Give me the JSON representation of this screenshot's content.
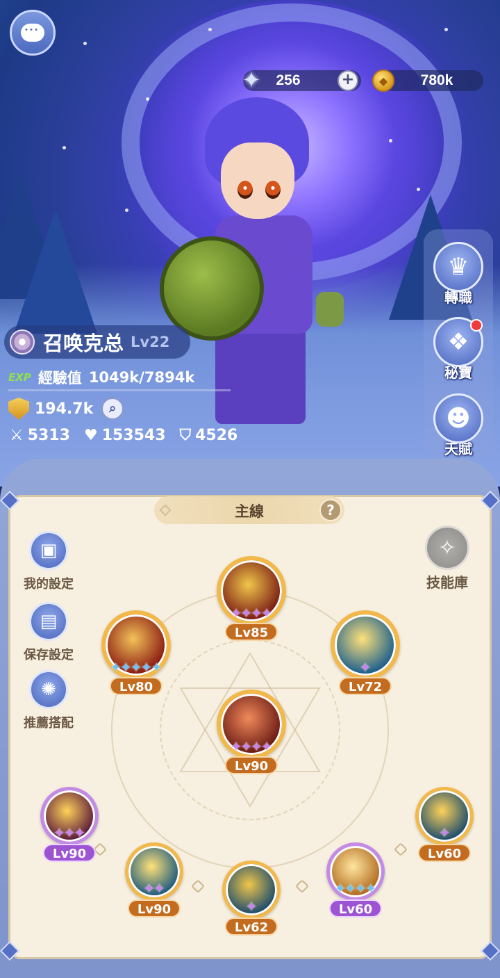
{
  "hud": {
    "chat_icon": "chat-bubble-icon",
    "gems": "256",
    "gold": "780k"
  },
  "player": {
    "name": "召唤克总",
    "level": "Lv22",
    "exp_tag": "EXP",
    "exp_label": "經驗值",
    "exp_value": "1049k/7894k",
    "power": "194.7k",
    "attack": "5313",
    "hp": "153543",
    "defense": "4526"
  },
  "side_menu": [
    {
      "label": "轉職",
      "icon": "class-change-icon",
      "badge": false
    },
    {
      "label": "秘寶",
      "icon": "treasure-chest-icon",
      "badge": true
    },
    {
      "label": "天賦",
      "icon": "talent-head-icon",
      "badge": false
    }
  ],
  "panel": {
    "tab_label": "主線",
    "help_label": "?",
    "left_buttons": [
      {
        "label": "我的設定",
        "icon": "card-settings-icon"
      },
      {
        "label": "保存設定",
        "icon": "save-disk-icon"
      },
      {
        "label": "推薦搭配",
        "icon": "recommend-combo-icon"
      }
    ],
    "skill_library_label": "技能庫"
  },
  "skills": [
    {
      "id": "top",
      "level": "Lv85",
      "stars": 4,
      "star_color": "pink",
      "pill": "orange",
      "colors": [
        "#f0c64a",
        "#7a1c14"
      ]
    },
    {
      "id": "upper-left",
      "level": "Lv80",
      "stars": 5,
      "star_color": "blue",
      "pill": "orange",
      "colors": [
        "#f2c25a",
        "#8a1a10"
      ]
    },
    {
      "id": "upper-right",
      "level": "Lv72",
      "stars": 1,
      "star_color": "pink",
      "pill": "orange",
      "colors": [
        "#ffe27a",
        "#1b5f8c"
      ]
    },
    {
      "id": "center",
      "level": "Lv90",
      "stars": 4,
      "star_color": "pink",
      "pill": "orange",
      "colors": [
        "#f08a5a",
        "#6a1a14"
      ]
    },
    {
      "id": "bottom-1",
      "level": "Lv90",
      "stars": 3,
      "star_color": "pink",
      "pill": "purple",
      "colors": [
        "#ffd25a",
        "#5a1a3a"
      ]
    },
    {
      "id": "bottom-2",
      "level": "Lv90",
      "stars": 2,
      "star_color": "pink",
      "pill": "orange",
      "colors": [
        "#ffe27a",
        "#1d5a7c"
      ]
    },
    {
      "id": "bottom-3",
      "level": "Lv62",
      "stars": 1,
      "star_color": "pink",
      "pill": "orange",
      "colors": [
        "#f0c64a",
        "#1c4c6c"
      ]
    },
    {
      "id": "bottom-4",
      "level": "Lv60",
      "stars": 4,
      "star_color": "blue",
      "pill": "purple",
      "colors": [
        "#ffe6a0",
        "#b06a1e"
      ]
    },
    {
      "id": "bottom-5",
      "level": "Lv60",
      "stars": 1,
      "star_color": "pink",
      "pill": "orange",
      "colors": [
        "#ffd25a",
        "#1c4c6c"
      ]
    }
  ]
}
